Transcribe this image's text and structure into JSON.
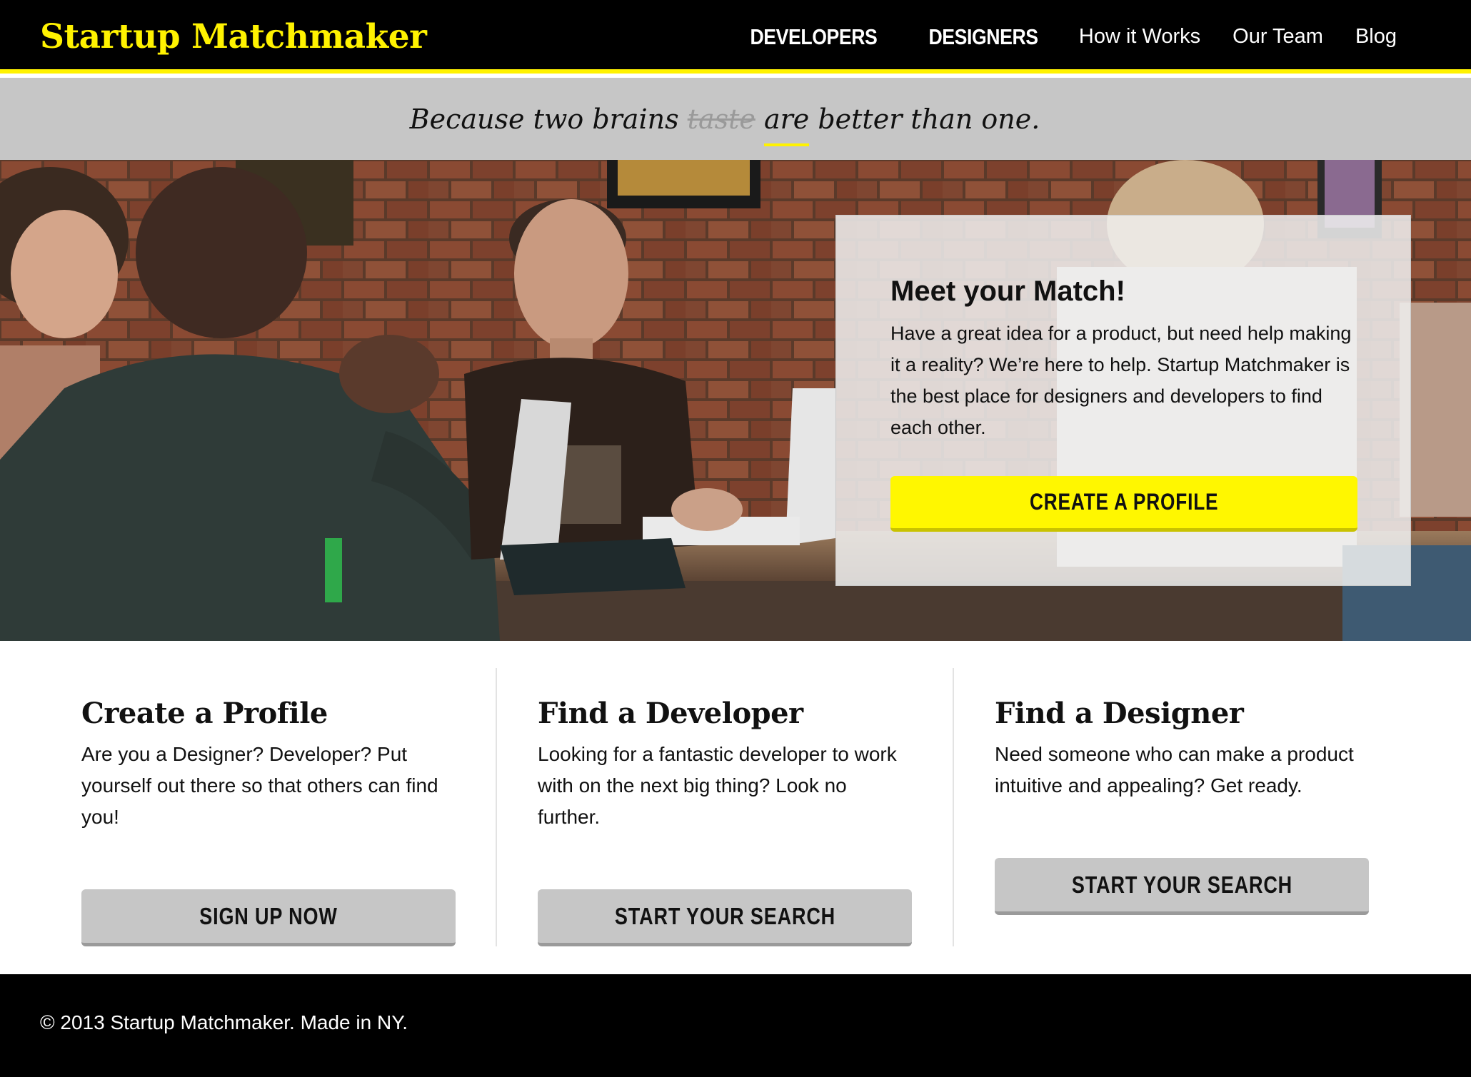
{
  "header": {
    "logo": "Startup Matchmaker",
    "nav": [
      {
        "label": "DEVELOPERS"
      },
      {
        "label": "DESIGNERS"
      },
      {
        "label": "How it Works"
      },
      {
        "label": "Our Team"
      },
      {
        "label": "Blog"
      }
    ]
  },
  "tagline": {
    "start": "Because two brains ",
    "struck": "taste",
    "underlined": "are",
    "end": " better than one."
  },
  "hero": {
    "title": "Meet your Match!",
    "text": "Have a great idea for a product, but need help making it a reality? We’re here to help. Startup Matchmaker is the best place for designers and developers to find each other.",
    "cta": "CREATE A PROFILE"
  },
  "features": [
    {
      "title": "Create a Profile",
      "text": "Are you a Designer? Developer? Put yourself out there so that others can find you!",
      "button": "SIGN UP NOW"
    },
    {
      "title": "Find a Developer",
      "text": "Looking for a fantastic developer to work with on the next big thing? Look no further.",
      "button": "START YOUR SEARCH"
    },
    {
      "title": "Find a Designer",
      "text": "Need someone who can make a product intuitive and appealing? Get ready.",
      "button": "START YOUR SEARCH"
    }
  ],
  "footer": {
    "text": "© 2013 Startup Matchmaker. Made in NY."
  },
  "colors": {
    "brand_yellow": "#fff200",
    "header_bg": "#000000",
    "tagline_bg": "#c6c6c6",
    "button_gray": "#c6c6c6"
  }
}
